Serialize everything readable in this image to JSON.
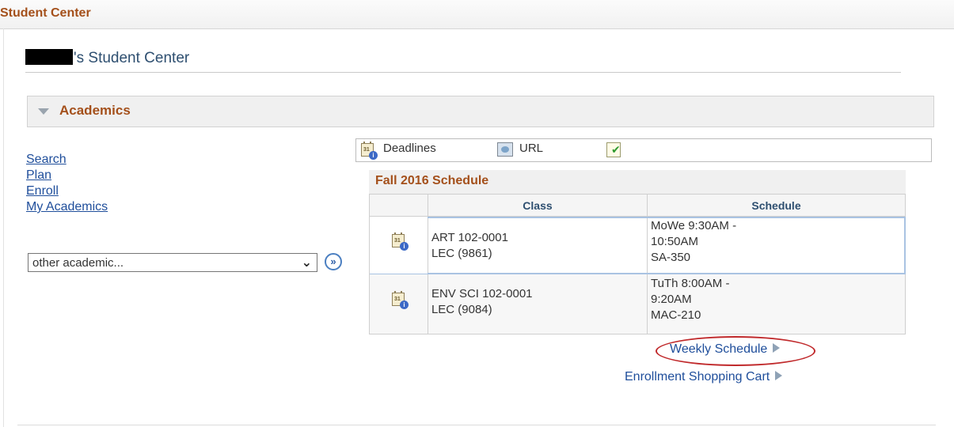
{
  "header": {
    "title": "Student Center"
  },
  "page": {
    "title_suffix": "'s Student Center"
  },
  "academics": {
    "section_label": "Academics",
    "links": [
      "Search",
      "Plan",
      "Enroll",
      "My Academics"
    ],
    "dropdown": {
      "selected": "other academic..."
    },
    "go_label": "»"
  },
  "toolbar": {
    "deadlines": "Deadlines",
    "url": "URL"
  },
  "schedule": {
    "title": "Fall 2016 Schedule",
    "columns": [
      "Class",
      "Schedule"
    ],
    "rows": [
      {
        "class_line1": "ART 102-0001",
        "class_line2": "LEC (9861)",
        "sched_line1": "MoWe 9:30AM -",
        "sched_line2": "10:50AM",
        "sched_line3": "SA-350"
      },
      {
        "class_line1": "ENV SCI 102-0001",
        "class_line2": "LEC (9084)",
        "sched_line1": "TuTh 8:00AM -",
        "sched_line2": "9:20AM",
        "sched_line3": "MAC-210"
      }
    ]
  },
  "links": {
    "weekly_schedule": "Weekly Schedule",
    "shopping_cart": "Enrollment Shopping Cart"
  },
  "colors": {
    "accent": "#a4501b",
    "link": "#1f4e9b",
    "highlight_circle": "#c0292b"
  }
}
